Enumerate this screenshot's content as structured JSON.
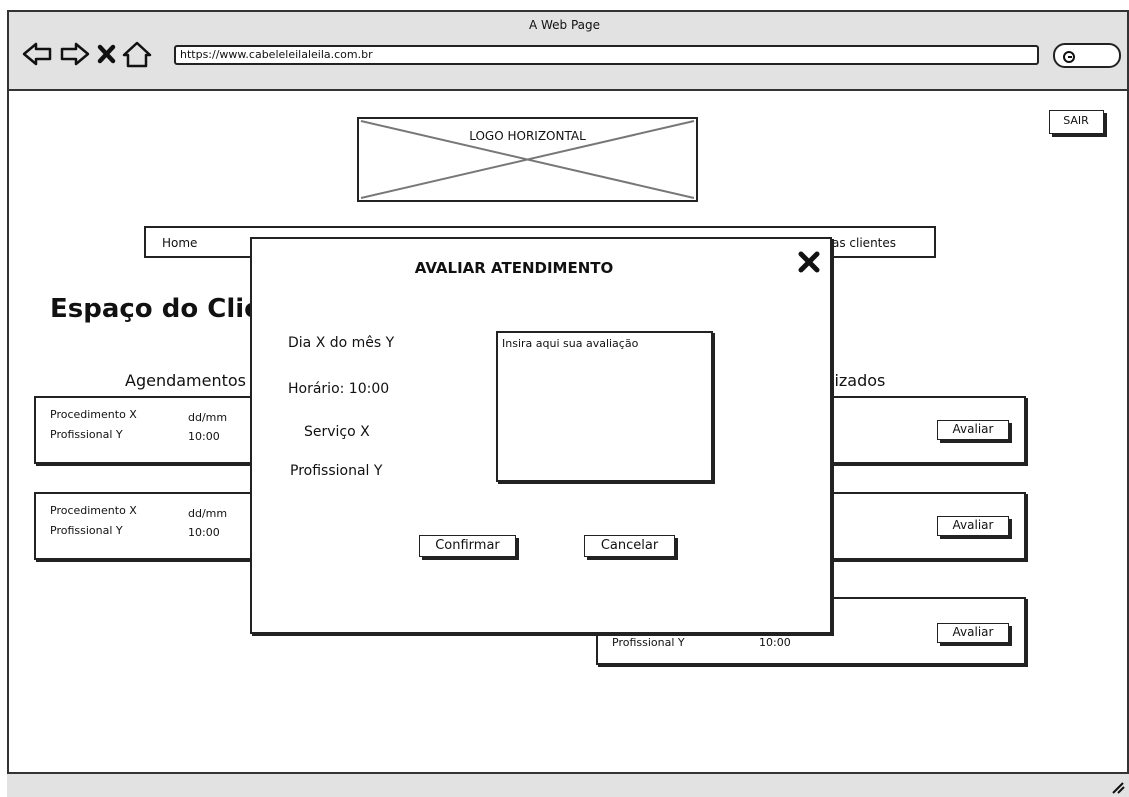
{
  "browser": {
    "title": "A Web Page",
    "url": "https://www.cabeleleilaleila.com.br"
  },
  "header": {
    "logo_label": "LOGO HORIZONTAL",
    "logout_label": "SAIR"
  },
  "nav": {
    "items": [
      "Home",
      "as clientes"
    ]
  },
  "page": {
    "title": "Espaço do Clie",
    "col_left": "Agendamentos",
    "col_right": "lizados"
  },
  "left_cards": [
    {
      "procedure": "Procedimento X",
      "professional": "Profissional Y",
      "date": "dd/mm",
      "time": "10:00"
    },
    {
      "procedure": "Procedimento X",
      "professional": "Profissional Y",
      "date": "dd/mm",
      "time": "10:00"
    }
  ],
  "right_cards": [
    {
      "action": "Avaliar"
    },
    {
      "action": "Avaliar"
    },
    {
      "action": "Avaliar",
      "professional": "Profissional Y",
      "time": "10:00"
    }
  ],
  "modal": {
    "title": "AVALIAR ATENDIMENTO",
    "day": "Dia X do mês Y",
    "time": "Horário: 10:00",
    "service": "Serviço X",
    "professional": "Profissional Y",
    "review_placeholder": "Insira aqui sua avaliação",
    "confirm_label": "Confirmar",
    "cancel_label": "Cancelar"
  }
}
